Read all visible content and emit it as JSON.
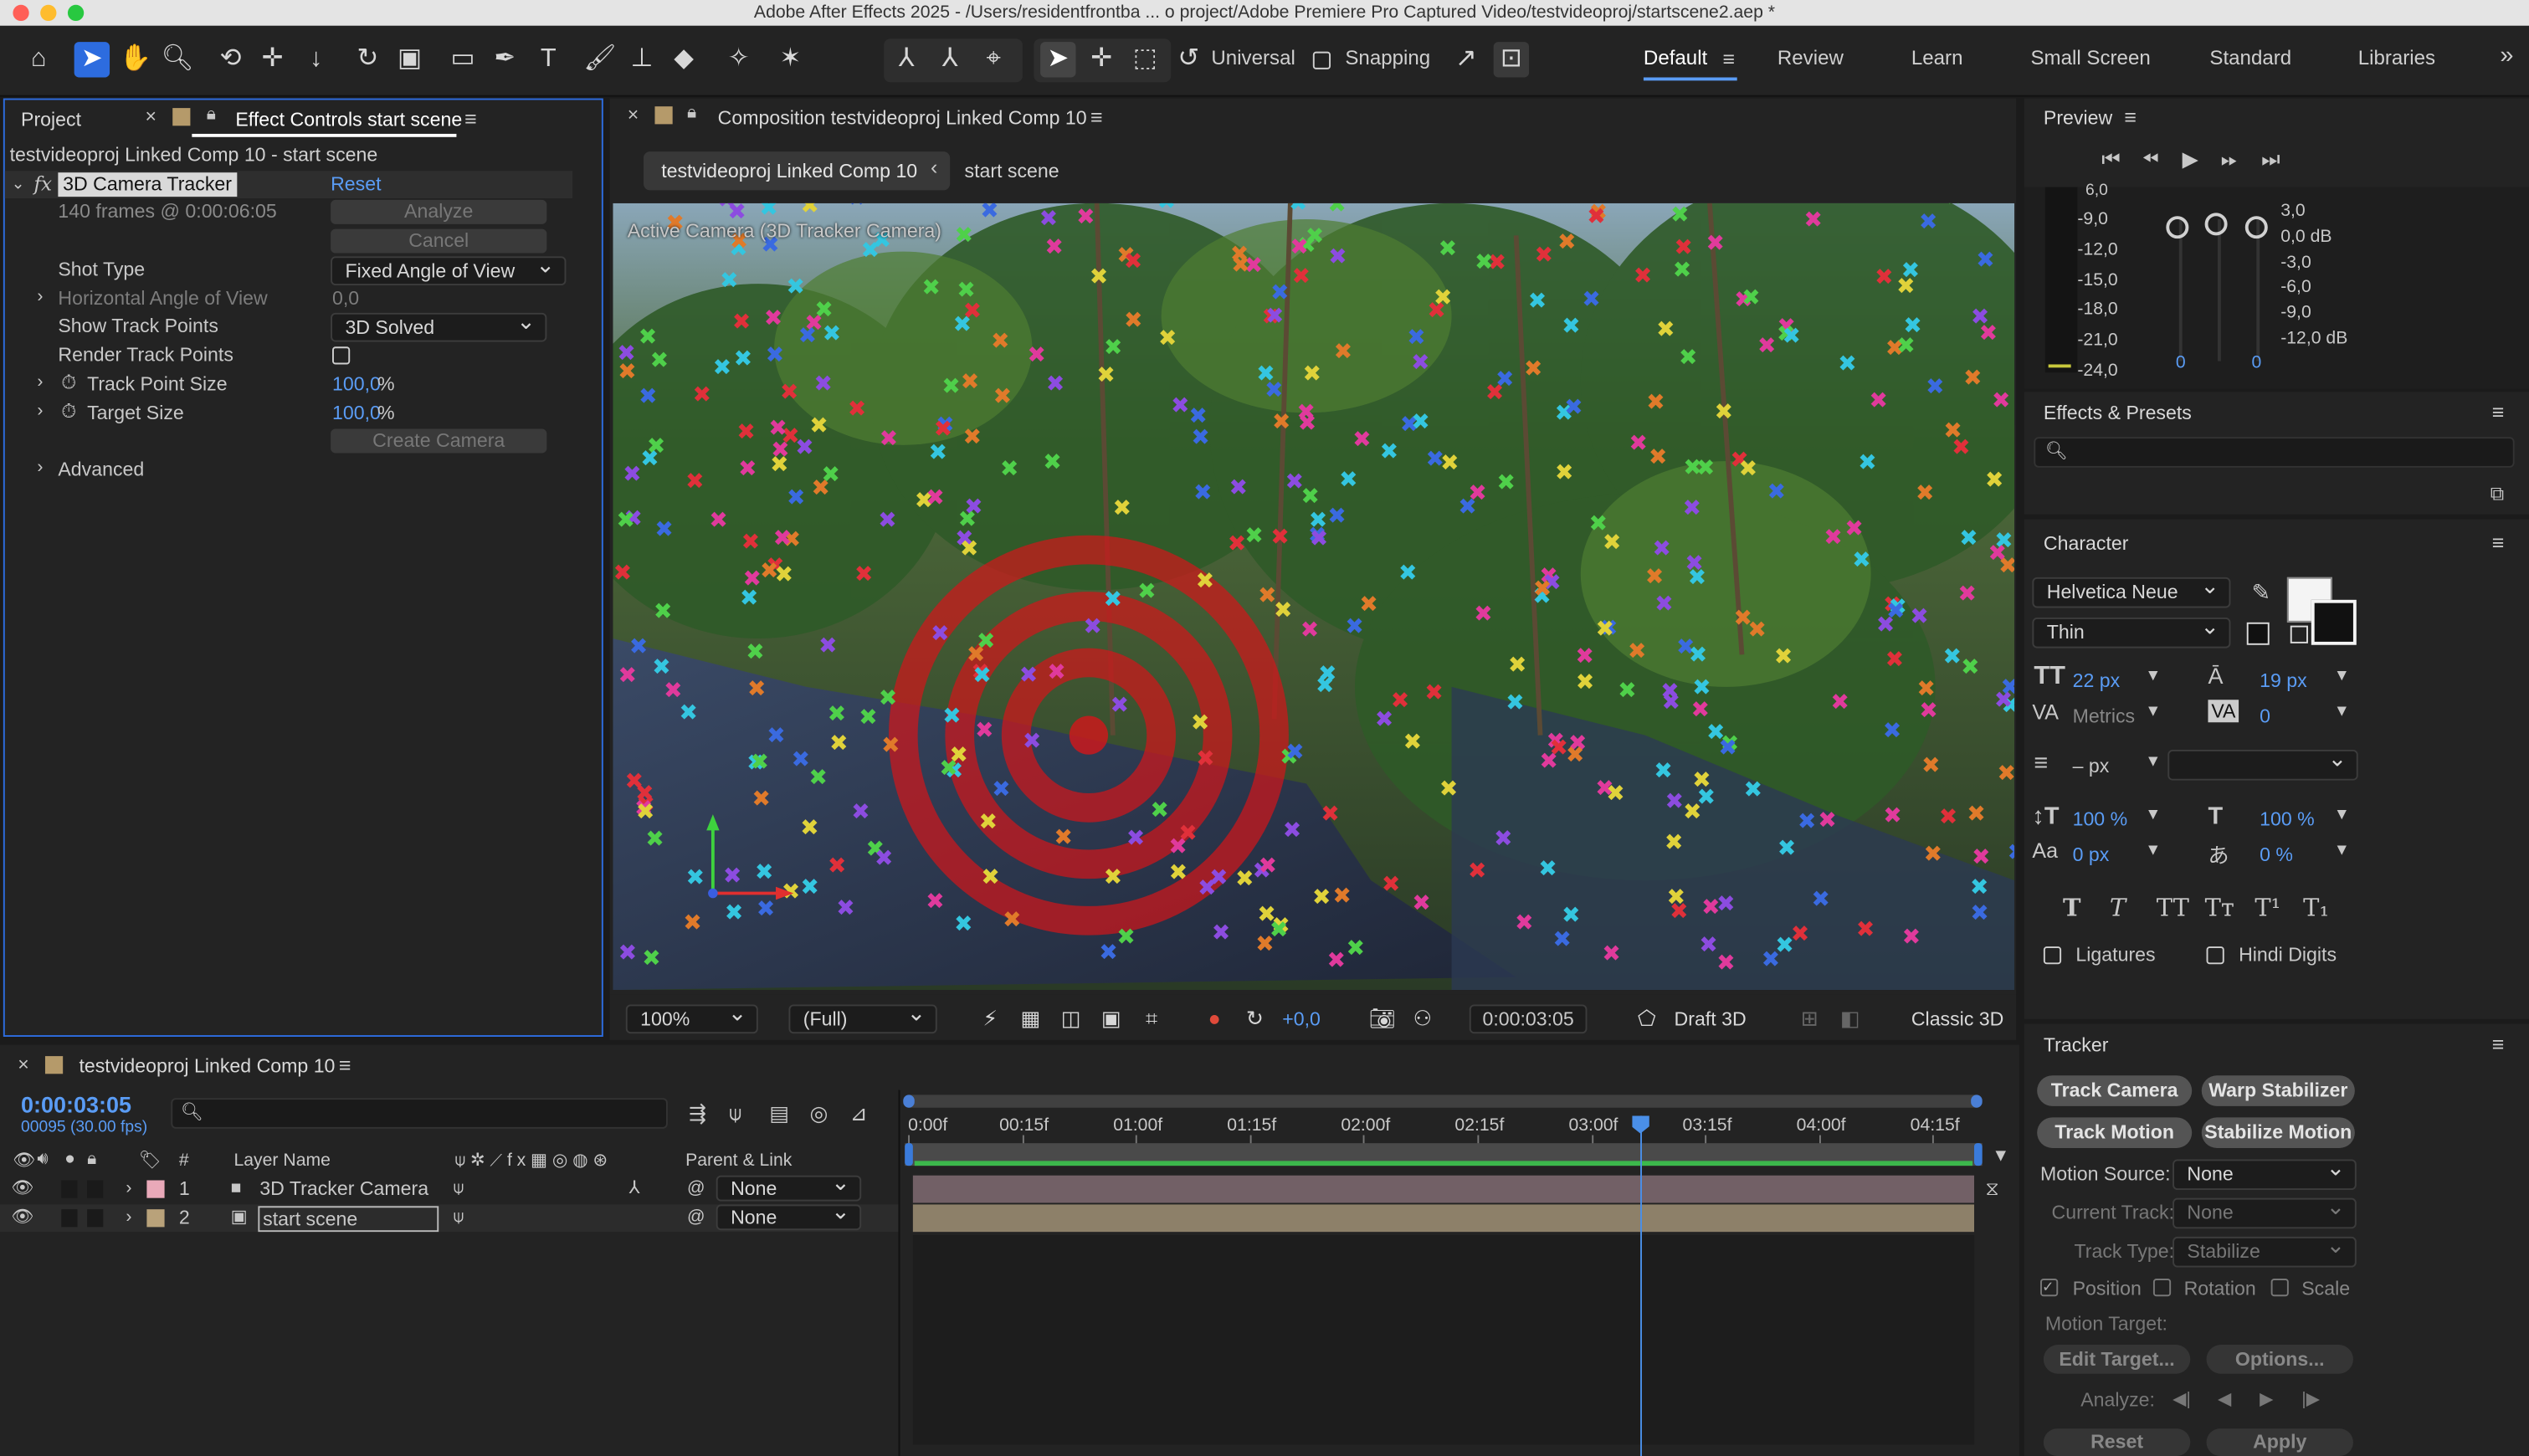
{
  "window": {
    "title": "Adobe After Effects 2025 - /Users/residentfrontba ... o project/Adobe Premiere Pro Captured Video/testvideoproj/startscene2.aep *"
  },
  "toolbar": {
    "axis_mode": "Universal",
    "snapping": "Snapping",
    "workspaces": [
      "Default",
      "Review",
      "Learn",
      "Small Screen",
      "Standard",
      "Libraries"
    ]
  },
  "left_panel": {
    "tabs": {
      "project": "Project",
      "effect_controls": "Effect Controls start scene"
    },
    "breadcrumb": "testvideoproj Linked Comp 10 - start scene",
    "effect_name": "3D Camera Tracker",
    "reset": "Reset",
    "frames_info": "140 frames @ 0:00:06:05",
    "analyze": "Analyze",
    "cancel": "Cancel",
    "shot_type_label": "Shot Type",
    "shot_type_value": "Fixed Angle of View",
    "hfov_label": "Horizontal Angle of View",
    "hfov_value": "0,0",
    "show_tp_label": "Show Track Points",
    "show_tp_value": "3D Solved",
    "render_tp_label": "Render Track Points",
    "tp_size_label": "Track Point Size",
    "tp_size_value": "100,0",
    "target_size_label": "Target Size",
    "target_size_value": "100,0",
    "percent": "%",
    "create_camera": "Create Camera",
    "advanced": "Advanced"
  },
  "composition": {
    "tab": "Composition testvideoproj Linked Comp 10",
    "crumb_active": "testvideoproj Linked Comp 10",
    "crumb_next": "start scene",
    "view_label": "Active Camera (3D Tracker Camera)",
    "zoom": "100%",
    "resolution": "(Full)",
    "exposure": "+0,0",
    "timecode": "0:00:03:05",
    "renderer": "Draft 3D",
    "engine": "Classic 3D"
  },
  "preview": {
    "title": "Preview",
    "left_scale": [
      "-9,0",
      "-12,0",
      "-15,0",
      "-18,0",
      "-21,0",
      "-24,0"
    ],
    "right_scale": [
      "3,0",
      "0,0 dB",
      "-3,0",
      "-6,0",
      "-9,0",
      "-12,0 dB"
    ],
    "top_label": "6,0",
    "knob_val_a": "0",
    "knob_val_b": "0"
  },
  "effects_presets": {
    "title": "Effects & Presets"
  },
  "character": {
    "title": "Character",
    "font": "Helvetica Neue",
    "style": "Thin",
    "size": "22 px",
    "leading": "19 px",
    "kerning": "Metrics",
    "tracking": "0",
    "stroke": "– px",
    "vscale": "100 %",
    "hscale": "100 %",
    "baseline": "0 px",
    "tsume": "0 %",
    "ligatures": "Ligatures",
    "hindi_digits": "Hindi Digits"
  },
  "tracker": {
    "title": "Tracker",
    "track_camera": "Track Camera",
    "warp_stabilizer": "Warp Stabilizer",
    "track_motion": "Track Motion",
    "stabilize_motion": "Stabilize Motion",
    "motion_source_label": "Motion Source:",
    "motion_source_value": "None",
    "current_track_label": "Current Track:",
    "current_track_value": "None",
    "track_type_label": "Track Type:",
    "track_type_value": "Stabilize",
    "position": "Position",
    "rotation": "Rotation",
    "scale": "Scale",
    "motion_target": "Motion Target:",
    "edit_target": "Edit Target...",
    "options": "Options...",
    "analyze_label": "Analyze:",
    "reset": "Reset",
    "apply": "Apply"
  },
  "timeline": {
    "tab": "testvideoproj Linked Comp 10",
    "timecode": "0:00:03:05",
    "frame_info": "00095 (30.00 fps)",
    "col_num": "#",
    "col_layer": "Layer Name",
    "col_parent": "Parent & Link",
    "ruler": [
      "0:00f",
      "00:15f",
      "01:00f",
      "01:15f",
      "02:00f",
      "02:15f",
      "03:00f",
      "03:15f",
      "04:00f",
      "04:15f"
    ],
    "playhead_fraction": 0.682,
    "layers": [
      {
        "num": "1",
        "name": "3D Tracker Camera",
        "parent": "None",
        "color": "#e9a9b9"
      },
      {
        "num": "2",
        "name": "start scene",
        "parent": "None",
        "color": "#b9a27a"
      }
    ]
  }
}
